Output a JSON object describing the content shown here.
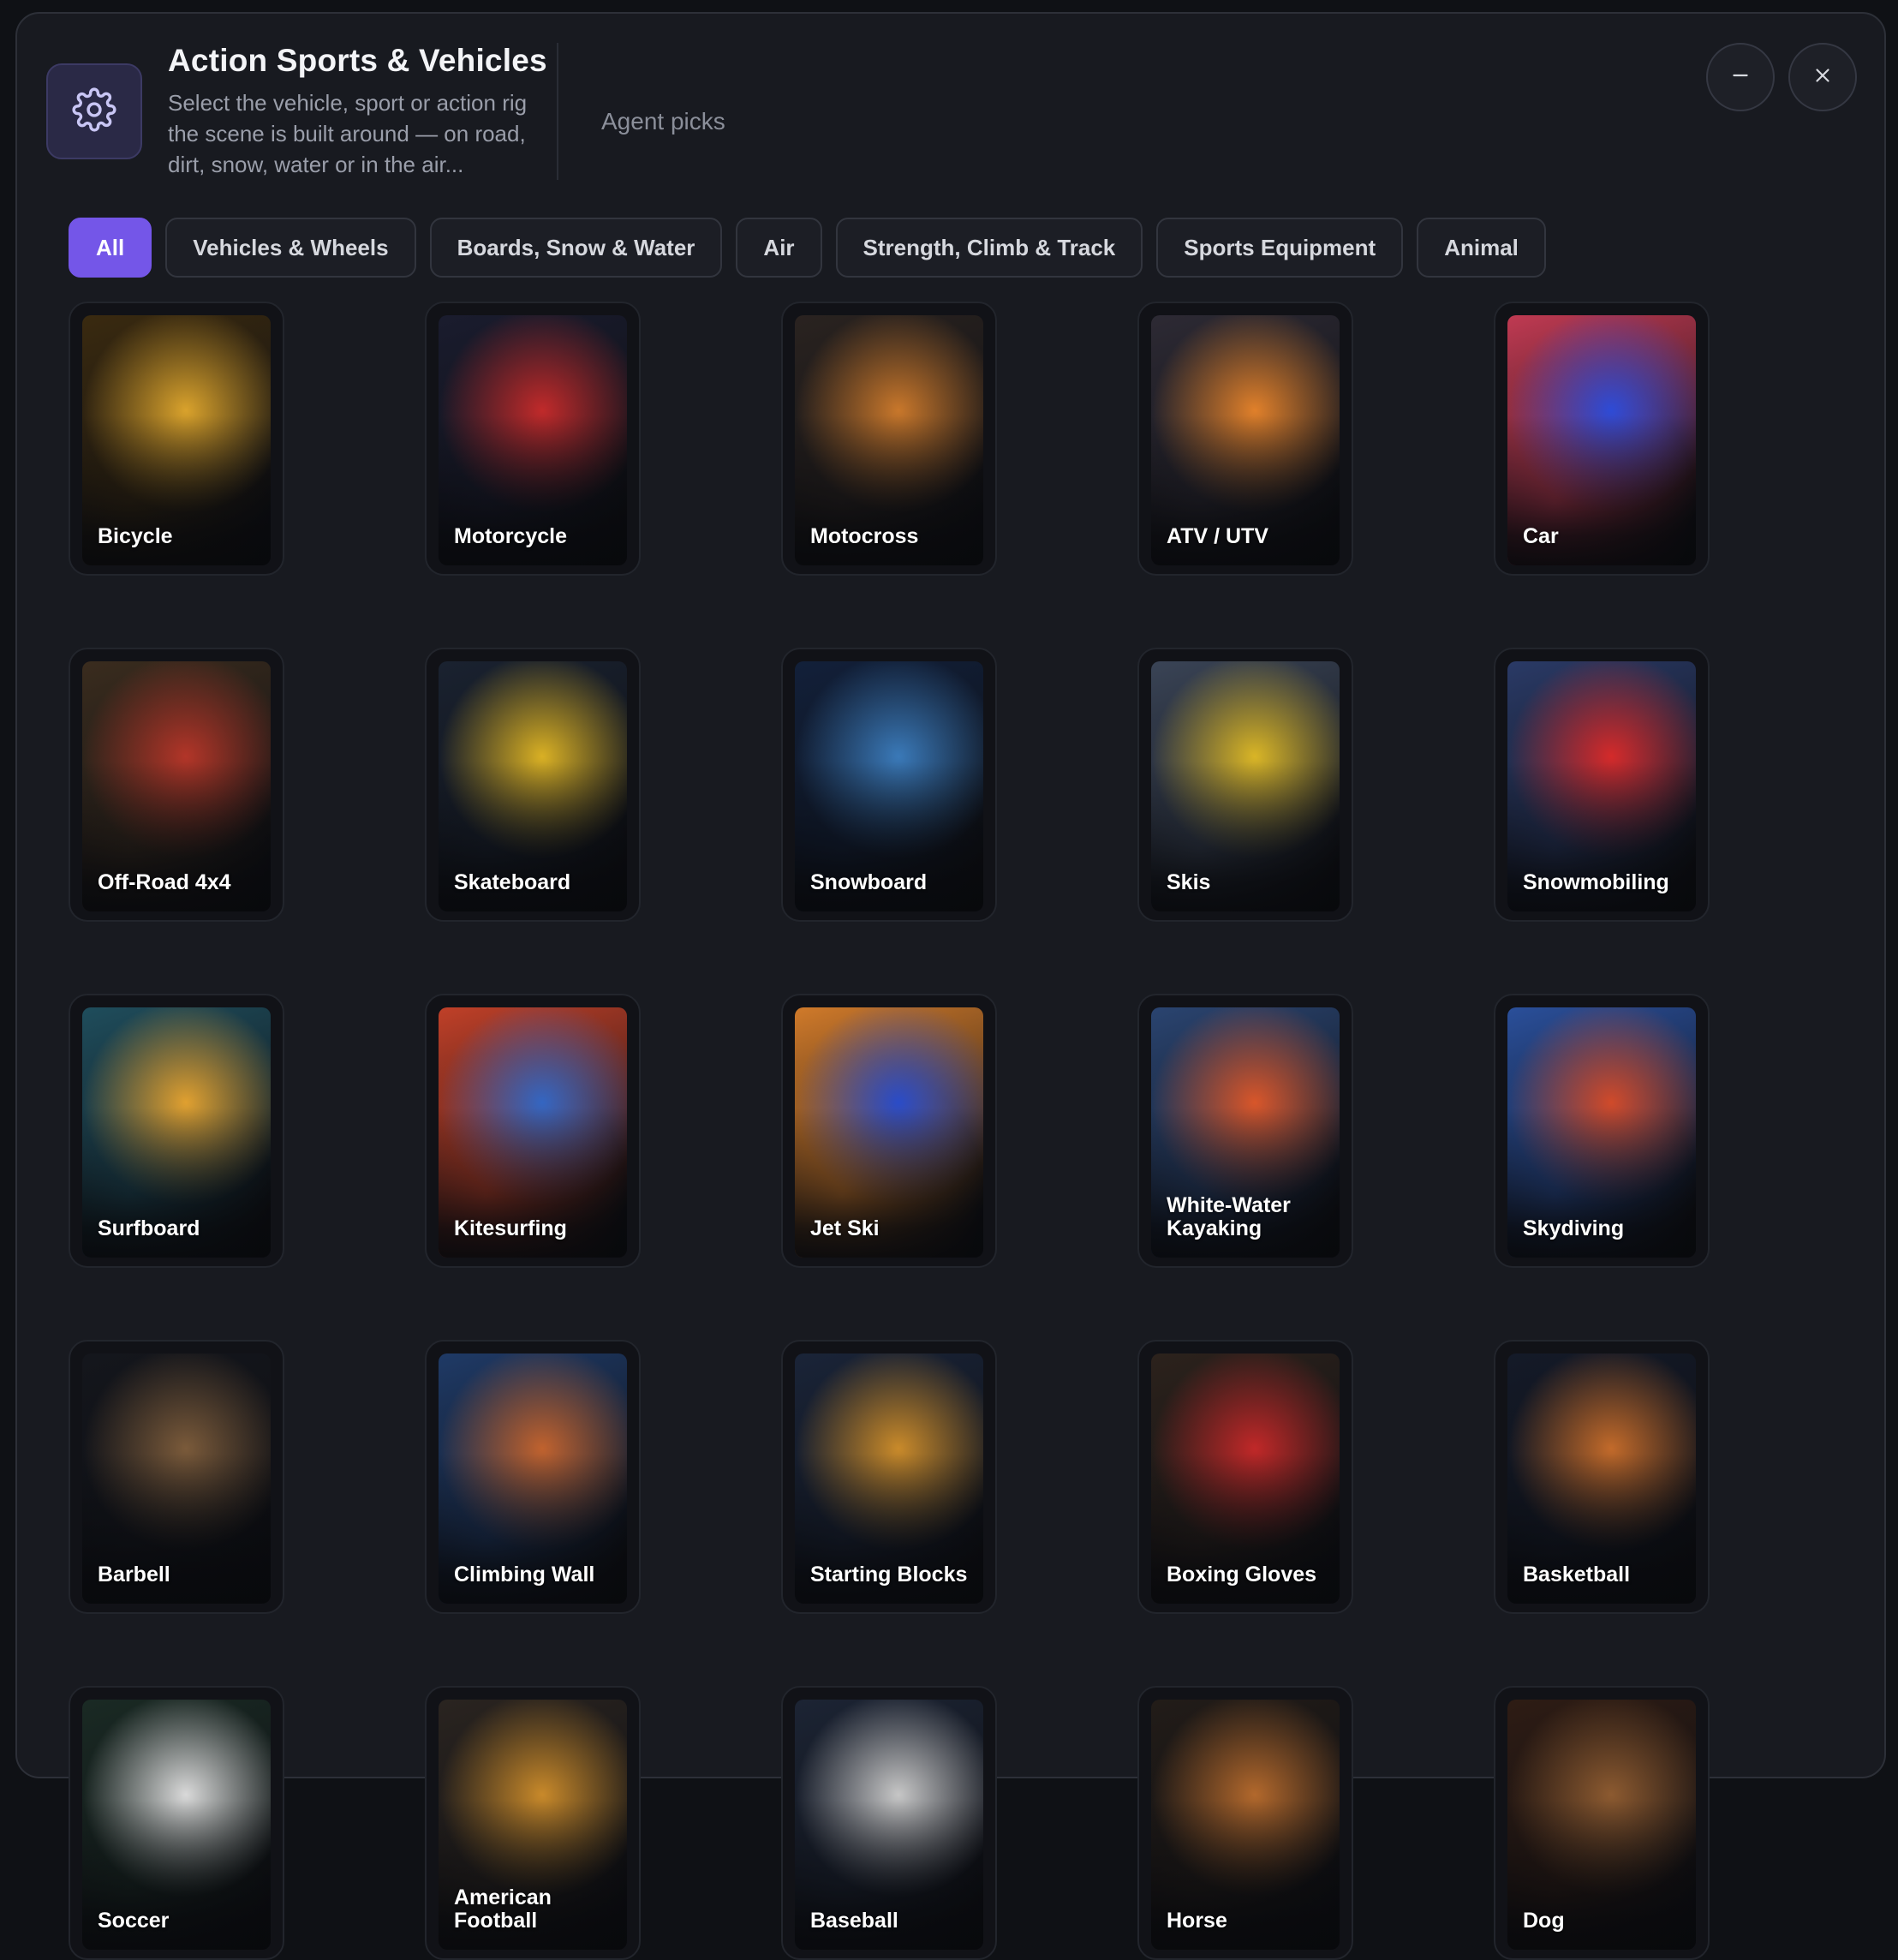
{
  "header": {
    "title": "Action Sports & Vehicles",
    "subtitle": "Select the vehicle, sport or action rig the scene is built around — on road, dirt, snow, water or in the air...",
    "agent_picks": "Agent picks",
    "logo_icon": "gear-icon",
    "minimize_icon": "minus-icon",
    "close_icon": "close-icon"
  },
  "filters": [
    {
      "label": "All",
      "active": true
    },
    {
      "label": "Vehicles & Wheels",
      "active": false
    },
    {
      "label": "Boards, Snow & Water",
      "active": false
    },
    {
      "label": "Air",
      "active": false
    },
    {
      "label": "Strength, Climb & Track",
      "active": false
    },
    {
      "label": "Sports Equipment",
      "active": false
    },
    {
      "label": "Animal",
      "active": false
    }
  ],
  "colors": {
    "accent": "#7456e8",
    "background": "#181a20",
    "card": "#111217"
  },
  "items": [
    {
      "label": "Bicycle",
      "c1": "#d9a22c",
      "c2": "#3a2a10"
    },
    {
      "label": "Motorcycle",
      "c1": "#c02a2a",
      "c2": "#1a1c2e"
    },
    {
      "label": "Motocross",
      "c1": "#c8772b",
      "c2": "#2a2320"
    },
    {
      "label": "ATV / UTV",
      "c1": "#e0802a",
      "c2": "#2d2a34"
    },
    {
      "label": "Car",
      "c1": "#2e4bd6",
      "c2": "#c03a52"
    },
    {
      "label": "Off-Road 4x4",
      "c1": "#b23528",
      "c2": "#3a2c1e"
    },
    {
      "label": "Skateboard",
      "c1": "#d9b024",
      "c2": "#1a2230"
    },
    {
      "label": "Snowboard",
      "c1": "#3a79b8",
      "c2": "#12203a"
    },
    {
      "label": "Skis",
      "c1": "#d9b526",
      "c2": "#3a4456"
    },
    {
      "label": "Snowmobiling",
      "c1": "#d42a2a",
      "c2": "#2a3a66"
    },
    {
      "label": "Surfboard",
      "c1": "#e0a030",
      "c2": "#1f4d5c"
    },
    {
      "label": "Kitesurfing",
      "c1": "#3466c2",
      "c2": "#c04028"
    },
    {
      "label": "Jet Ski",
      "c1": "#2a4cc8",
      "c2": "#d07a2a"
    },
    {
      "label": "White-Water Kayaking",
      "c1": "#d8562a",
      "c2": "#2a4470"
    },
    {
      "label": "Skydiving",
      "c1": "#d04a2a",
      "c2": "#2a4f9a"
    },
    {
      "label": "Barbell",
      "c1": "#7a5a3a",
      "c2": "#14161c"
    },
    {
      "label": "Climbing Wall",
      "c1": "#c0622e",
      "c2": "#1f3a66"
    },
    {
      "label": "Starting Blocks",
      "c1": "#c98a2a",
      "c2": "#1a2438"
    },
    {
      "label": "Boxing Gloves",
      "c1": "#c02828",
      "c2": "#2c221c"
    },
    {
      "label": "Basketball",
      "c1": "#c26a2a",
      "c2": "#141a28"
    },
    {
      "label": "Soccer",
      "c1": "#d9d9d9",
      "c2": "#1a2a24"
    },
    {
      "label": "American Football",
      "c1": "#c8892a",
      "c2": "#2a2420"
    },
    {
      "label": "Baseball",
      "c1": "#c6c6c6",
      "c2": "#1c2434"
    },
    {
      "label": "Horse",
      "c1": "#b2682c",
      "c2": "#221c18"
    },
    {
      "label": "Dog",
      "c1": "#8c5a30",
      "c2": "#2e1c14"
    }
  ]
}
